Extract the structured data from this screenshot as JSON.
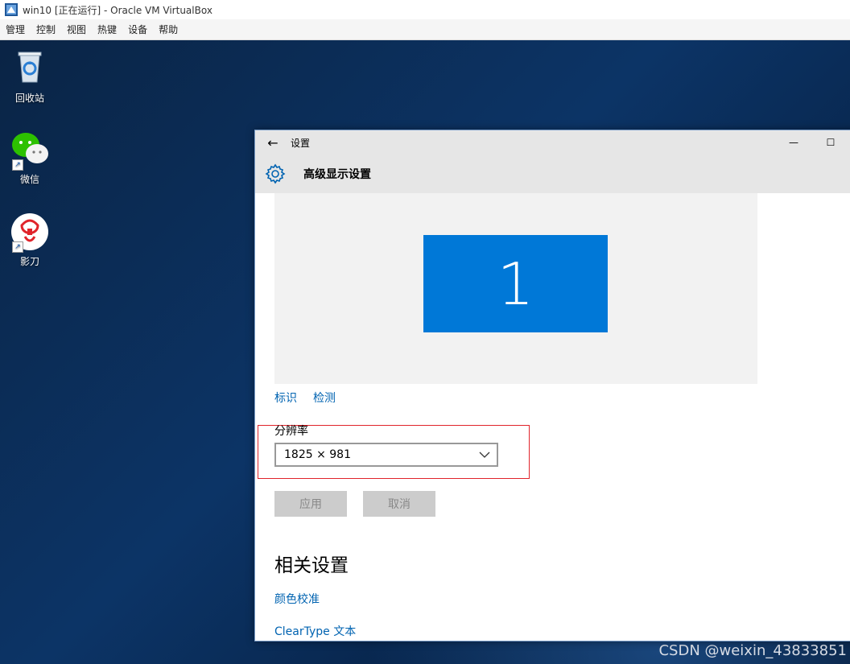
{
  "vbox": {
    "title": "win10 [正在运行] - Oracle VM VirtualBox",
    "menu": [
      "管理",
      "控制",
      "视图",
      "热键",
      "设备",
      "帮助"
    ]
  },
  "desktop": {
    "icons": [
      {
        "label": "回收站",
        "icon": "recycle-bin-icon"
      },
      {
        "label": "微信",
        "icon": "wechat-icon"
      },
      {
        "label": "影刀",
        "icon": "yingdao-icon"
      }
    ]
  },
  "settings": {
    "window_title": "设置",
    "page_title": "高级显示设置",
    "monitor_number": "1",
    "links": {
      "identify": "标识",
      "detect": "检测"
    },
    "resolution_label": "分辨率",
    "resolution_value": "1825 × 981",
    "apply_label": "应用",
    "cancel_label": "取消",
    "related_title": "相关设置",
    "related_links": [
      "颜色校准",
      "ClearType 文本"
    ]
  },
  "watermark": "CSDN @weixin_43833851",
  "colors": {
    "accent": "#0078d7",
    "link": "#0063b1",
    "highlight": "#e0242b"
  }
}
